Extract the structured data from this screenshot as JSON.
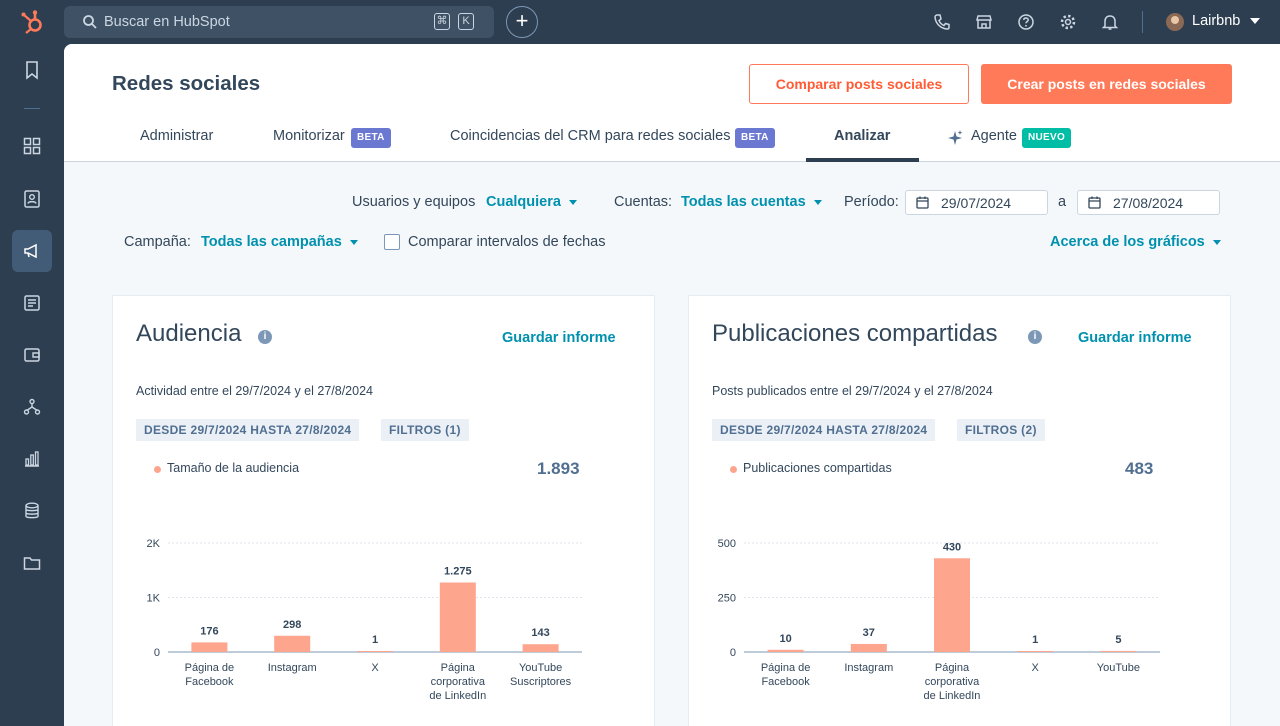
{
  "topbar": {
    "search_placeholder": "Buscar en HubSpot",
    "kbd_cmd": "⌘",
    "kbd_k": "K",
    "add": "+",
    "user": "Lairbnb",
    "icons": [
      "phone-icon",
      "marketplace-icon",
      "help-icon",
      "settings-icon",
      "notifications-icon"
    ]
  },
  "header": {
    "title": "Redes sociales",
    "compare_button": "Comparar posts sociales",
    "create_button": "Crear posts en redes sociales",
    "tabs": [
      {
        "label": "Administrar"
      },
      {
        "label": "Monitorizar",
        "badge": "BETA"
      },
      {
        "label": "Coincidencias del CRM para redes sociales",
        "badge": "BETA"
      },
      {
        "label": "Analizar"
      },
      {
        "label": "Agente",
        "badge": "NUEVO"
      }
    ]
  },
  "filters": {
    "users_label": "Usuarios y equipos",
    "users_value": "Cualquiera",
    "accounts_label": "Cuentas:",
    "accounts_value": "Todas las cuentas",
    "period_label": "Período:",
    "date_from": "29/07/2024",
    "date_sep": "a",
    "date_to": "27/08/2024",
    "campaign_label": "Campaña:",
    "campaign_value": "Todas las campañas",
    "compare_label": "Comparar intervalos de fechas",
    "about_charts": "Acerca de los gráficos"
  },
  "cards": [
    {
      "title": "Audiencia",
      "save": "Guardar informe",
      "subtitle": "Actividad entre el 29/7/2024 y el 27/8/2024",
      "tag_range": "DESDE 29/7/2024 HASTA 27/8/2024",
      "tag_filters": "FILTROS (1)",
      "legend": "Tamaño de la audiencia",
      "total": "1.893"
    },
    {
      "title": "Publicaciones compartidas",
      "save": "Guardar informe",
      "subtitle": "Posts publicados entre el 29/7/2024 y el 27/8/2024",
      "tag_range": "DESDE 29/7/2024 HASTA 27/8/2024",
      "tag_filters": "FILTROS (2)",
      "legend": "Publicaciones compartidas",
      "total": "483"
    }
  ],
  "chart_data": [
    {
      "type": "bar",
      "categories": [
        [
          "Página de",
          "Facebook"
        ],
        [
          "Instagram"
        ],
        [
          "X"
        ],
        [
          "Página",
          "corporativa",
          "de LinkedIn"
        ],
        [
          "YouTube",
          "Suscriptores"
        ]
      ],
      "values": [
        176,
        298,
        1,
        1275,
        143
      ],
      "value_labels": [
        "176",
        "298",
        "1",
        "1.275",
        "143"
      ],
      "ylim": [
        0,
        2000
      ],
      "yticks": [
        0,
        1000,
        2000
      ],
      "ytick_labels": [
        "0",
        "1K",
        "2K"
      ],
      "color": "#fea58e"
    },
    {
      "type": "bar",
      "categories": [
        [
          "Página de",
          "Facebook"
        ],
        [
          "Instagram"
        ],
        [
          "Página",
          "corporativa",
          "de LinkedIn"
        ],
        [
          "X"
        ],
        [
          "YouTube"
        ]
      ],
      "values": [
        10,
        37,
        430,
        1,
        5
      ],
      "value_labels": [
        "10",
        "37",
        "430",
        "1",
        "5"
      ],
      "ylim": [
        0,
        500
      ],
      "yticks": [
        0,
        250,
        500
      ],
      "ytick_labels": [
        "0",
        "250",
        "500"
      ],
      "color": "#fea58e"
    }
  ]
}
